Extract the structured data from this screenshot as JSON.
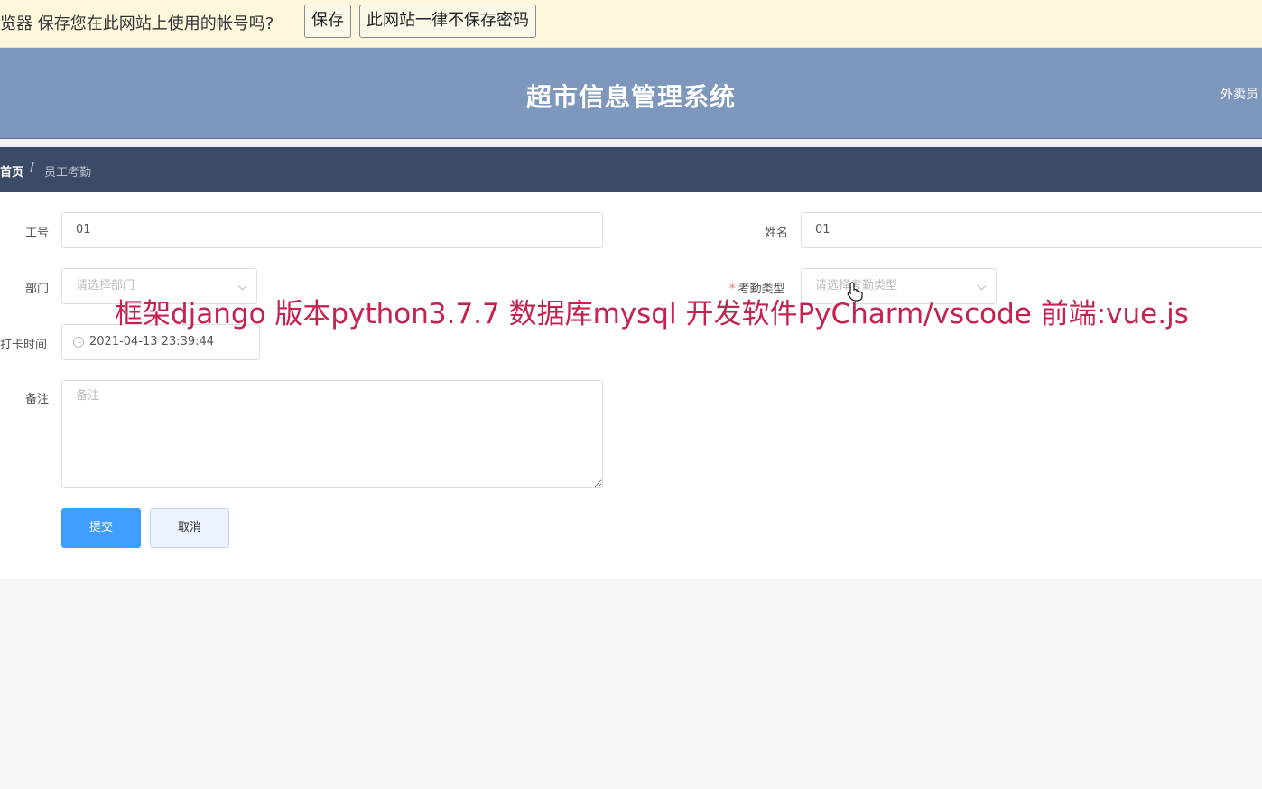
{
  "password_bar": {
    "message": "览器 保存您在此网站上使用的帐号吗?",
    "save_label": "保存",
    "never_label": "此网站一律不保存密码"
  },
  "header": {
    "title": "超市信息管理系统",
    "user": "外卖员"
  },
  "breadcrumb": {
    "home": "首页",
    "separator": "/",
    "current": "员工考勤"
  },
  "form": {
    "employee_id": {
      "label": "工号",
      "value": "01"
    },
    "name": {
      "label": "姓名",
      "value": "01"
    },
    "department": {
      "label": "部门",
      "placeholder": "请选择部门"
    },
    "attendance_type": {
      "label": "考勤类型",
      "required_mark": "*",
      "placeholder": "请选择考勤类型"
    },
    "clock_time": {
      "label": "打卡时间",
      "value": "2021-04-13 23:39:44"
    },
    "remark": {
      "label": "备注",
      "placeholder": "备注"
    },
    "submit_label": "提交",
    "cancel_label": "取消"
  },
  "watermark": "框架django 版本python3.7.7 数据库mysql  开发软件PyCharm/vscode 前端:vue.js",
  "colors": {
    "header_bg": "#7e97bc",
    "breadcrumb_bg": "#3b4a66",
    "primary": "#409eff",
    "watermark": "#c4224f",
    "required": "#f56c6c"
  }
}
